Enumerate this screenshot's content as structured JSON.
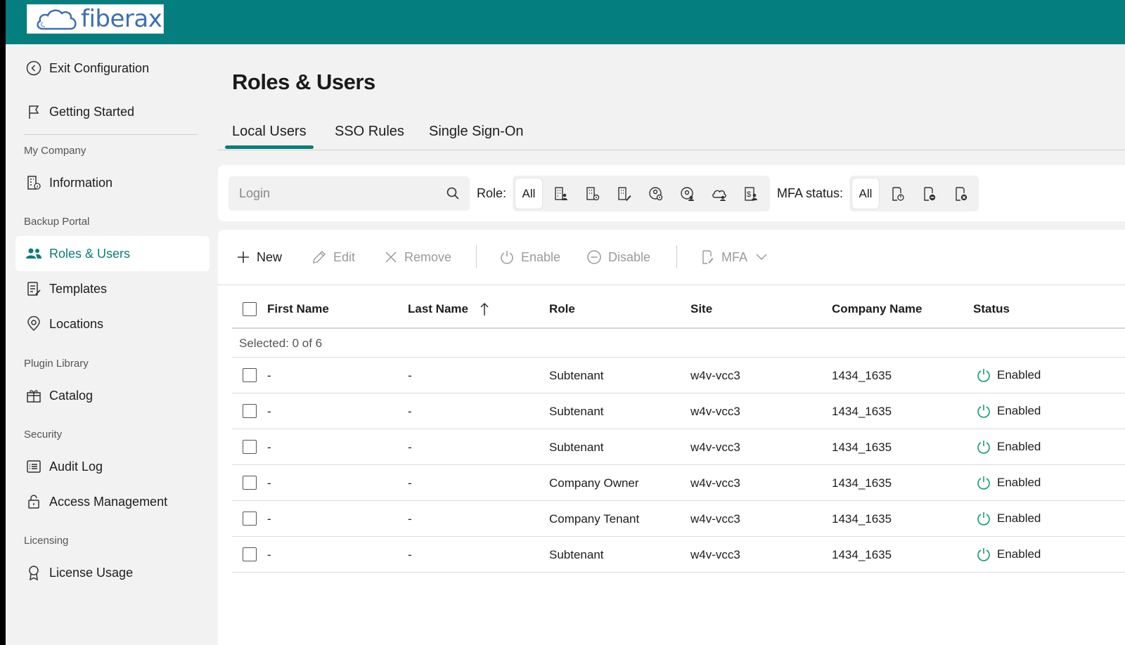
{
  "header": {
    "logo_text": "fiberax"
  },
  "sidebar": {
    "exit": "Exit Configuration",
    "getting_started": "Getting Started",
    "sections": {
      "my_company": "My Company",
      "backup_portal": "Backup Portal",
      "plugin_library": "Plugin Library",
      "security": "Security",
      "licensing": "Licensing"
    },
    "items": {
      "information": "Information",
      "roles_users": "Roles & Users",
      "templates": "Templates",
      "locations": "Locations",
      "catalog": "Catalog",
      "audit_log": "Audit Log",
      "access_management": "Access Management",
      "license_usage": "License Usage"
    }
  },
  "page": {
    "title": "Roles & Users",
    "tabs": [
      "Local Users",
      "SSO Rules",
      "Single Sign-On"
    ],
    "active_tab": "Local Users"
  },
  "filters": {
    "search_placeholder": "Login",
    "role_label": "Role:",
    "role_all": "All",
    "role_icons": [
      "company-owner-icon",
      "company-admin-icon",
      "company-tenant-icon",
      "subtenant-icon",
      "reseller-icon",
      "cloud-tenant-icon",
      "invoice-user-icon"
    ],
    "mfa_label": "MFA status:",
    "mfa_all": "All",
    "mfa_icons": [
      "mfa-enabled-icon",
      "mfa-disabled-icon",
      "mfa-not-configured-icon"
    ]
  },
  "toolbar": {
    "new": "New",
    "edit": "Edit",
    "remove": "Remove",
    "enable": "Enable",
    "disable": "Disable",
    "mfa": "MFA"
  },
  "table": {
    "columns": [
      "First Name",
      "Last Name",
      "Role",
      "Site",
      "Company Name",
      "Status"
    ],
    "sorted_column": "Last Name",
    "sort_direction": "ascending",
    "selected_text": "Selected: 0 of 6",
    "rows": [
      {
        "first": "-",
        "last": "-",
        "role": "Subtenant",
        "site": "w4v-vcc3",
        "company": "1434_1635",
        "status": "Enabled"
      },
      {
        "first": "-",
        "last": "-",
        "role": "Subtenant",
        "site": "w4v-vcc3",
        "company": "1434_1635",
        "status": "Enabled"
      },
      {
        "first": "-",
        "last": "-",
        "role": "Subtenant",
        "site": "w4v-vcc3",
        "company": "1434_1635",
        "status": "Enabled"
      },
      {
        "first": "-",
        "last": "-",
        "role": "Company Owner",
        "site": "w4v-vcc3",
        "company": "1434_1635",
        "status": "Enabled"
      },
      {
        "first": "-",
        "last": "-",
        "role": "Company Tenant",
        "site": "w4v-vcc3",
        "company": "1434_1635",
        "status": "Enabled"
      },
      {
        "first": "-",
        "last": "-",
        "role": "Subtenant",
        "site": "w4v-vcc3",
        "company": "1434_1635",
        "status": "Enabled"
      }
    ]
  },
  "colors": {
    "brand": "#057e80",
    "accent": "#0a7d7a",
    "status_enabled": "#1a9c6b"
  }
}
